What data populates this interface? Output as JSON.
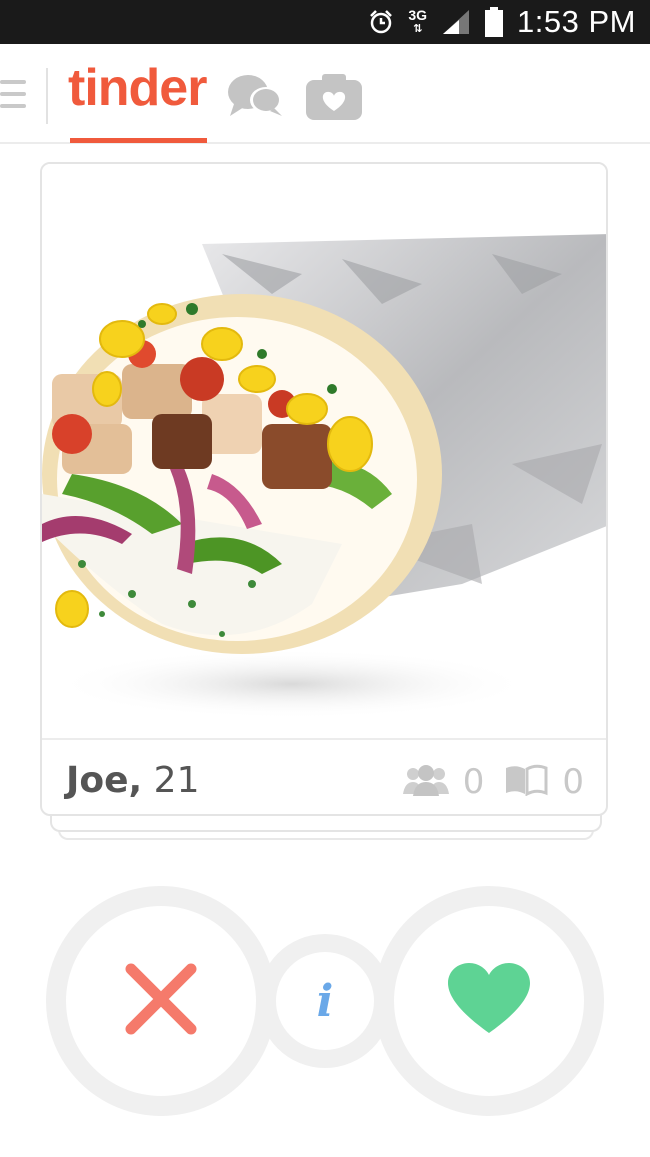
{
  "status_bar": {
    "time": "1:53 PM",
    "network": "3G",
    "icons": [
      "alarm-icon",
      "network-3g-icon",
      "signal-icon",
      "battery-icon"
    ]
  },
  "header": {
    "logo_text": "tinder",
    "brand_color": "#f05a3c",
    "icons": [
      "menu-icon",
      "chat-icon",
      "camera-icon"
    ]
  },
  "card": {
    "photo_subject": "burrito",
    "name": "Joe,",
    "age": "21",
    "shared_friends_count": "0",
    "shared_interests_count": "0"
  },
  "actions": {
    "info_label": "i",
    "dislike_color": "#f57a6b",
    "like_color": "#5ed394",
    "info_color": "#6aa8e8"
  }
}
